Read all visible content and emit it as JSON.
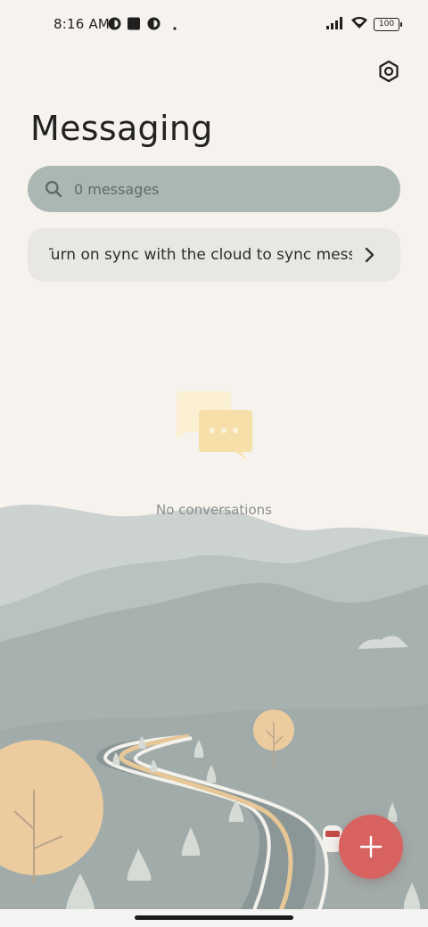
{
  "status_bar": {
    "time": "8:16 AM",
    "battery": "100",
    "icons": [
      "notification-app-icon",
      "square-notification-icon",
      "notification-app-icon",
      "dot-icon",
      "signal-icon",
      "wifi-icon",
      "battery-icon"
    ]
  },
  "header": {
    "title": "Messaging",
    "settings_icon": "settings-icon"
  },
  "search": {
    "placeholder": "0 messages",
    "icon": "search-icon"
  },
  "sync_banner": {
    "text": "Turn on sync with the cloud to sync messages",
    "icon": "chevron-right-icon"
  },
  "empty_state": {
    "icon": "chat-bubbles-icon",
    "text": "No conversations"
  },
  "fab": {
    "icon": "plus-icon",
    "color": "#d8625f"
  },
  "colors": {
    "background": "#f6f3ee",
    "search_bg": "#aab7b3",
    "banner_bg": "#e9e7e2",
    "accent": "#d8625f"
  }
}
